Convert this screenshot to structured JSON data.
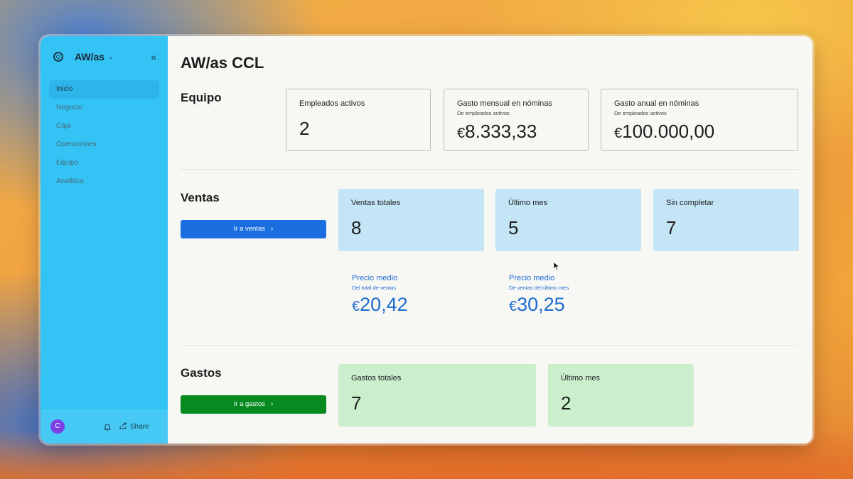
{
  "sidebar": {
    "workspace": "AW/as",
    "nav": [
      "Inicio",
      "Negocio",
      "Caja",
      "Operaciones",
      "Equipo",
      "Analítica"
    ],
    "active": "Inicio",
    "avatar_initial": "C",
    "share_label": "Share"
  },
  "main": {
    "title": "AW/as CCL",
    "equipo": {
      "title": "Equipo",
      "cards": [
        {
          "label": "Empleados activos",
          "sub": "",
          "value": "2"
        },
        {
          "label": "Gasto mensual en nóminas",
          "sub": "De empleados activos",
          "currency": "€",
          "value": "8.333,33"
        },
        {
          "label": "Gasto anual en nóminas",
          "sub": "De empleados activos",
          "currency": "€",
          "value": "100.000,00"
        }
      ]
    },
    "ventas": {
      "title": "Ventas",
      "button": "Ir a ventas",
      "cards": [
        {
          "label": "Ventas totales",
          "value": "8"
        },
        {
          "label": "Último mes",
          "value": "5"
        },
        {
          "label": "Sin completar",
          "value": "7"
        }
      ],
      "stats": [
        {
          "label": "Precio medio",
          "sub": "Del total de ventas",
          "currency": "€",
          "value": "20,42"
        },
        {
          "label": "Precio medio",
          "sub": "De ventas del último mes",
          "currency": "€",
          "value": "30,25"
        }
      ]
    },
    "gastos": {
      "title": "Gastos",
      "button": "Ir a gastos",
      "cards": [
        {
          "label": "Gastos totales",
          "value": "7"
        },
        {
          "label": "Último mes",
          "value": "2"
        }
      ]
    }
  },
  "colors": {
    "sidebar": "#33c3f5",
    "primary_button": "#1a6ee0",
    "success_button": "#078a20",
    "blue_card": "#c3e5f6",
    "green_card": "#cbefcd",
    "stat_text": "#1f6ccf"
  },
  "icons": [
    "settings-logo-icon",
    "chevron-down-icon",
    "collapse-sidebar-icon",
    "bell-icon",
    "share-icon",
    "chevron-right-icon",
    "mouse-cursor-icon"
  ]
}
